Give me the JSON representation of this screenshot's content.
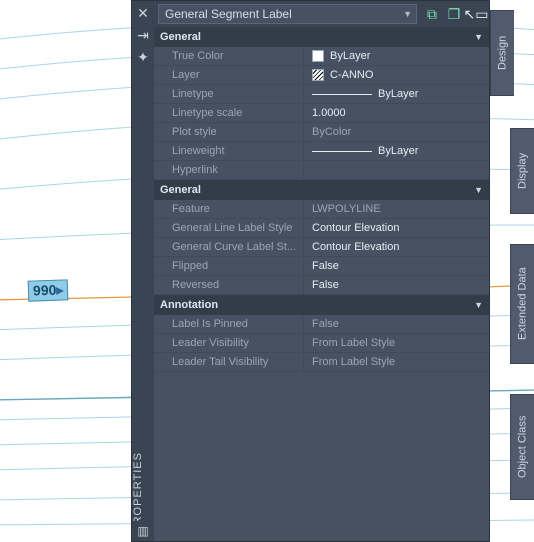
{
  "palette_title": "PROPERTIES",
  "object_selector": "General Segment Label",
  "side_tabs": {
    "design": "Design",
    "display": "Display",
    "extended": "Extended Data",
    "objclass": "Object Class"
  },
  "sections": [
    {
      "title": "General",
      "rows": [
        {
          "label": "True Color",
          "value": "ByLayer",
          "swatch": "white"
        },
        {
          "label": "Layer",
          "value": "C-ANNO",
          "swatch": "hatch"
        },
        {
          "label": "Linetype",
          "value": "ByLayer",
          "line": true
        },
        {
          "label": "Linetype scale",
          "value": "1.0000"
        },
        {
          "label": "Plot style",
          "value": "ByColor",
          "dim": true
        },
        {
          "label": "Lineweight",
          "value": "ByLayer",
          "line": true
        },
        {
          "label": "Hyperlink",
          "value": ""
        }
      ]
    },
    {
      "title": "General",
      "rows": [
        {
          "label": "Feature",
          "value": "LWPOLYLINE",
          "dim": true
        },
        {
          "label": "General Line Label Style",
          "value": "Contour Elevation"
        },
        {
          "label": "General Curve Label St...",
          "value": "Contour Elevation"
        },
        {
          "label": "Flipped",
          "value": "False"
        },
        {
          "label": "Reversed",
          "value": "False"
        }
      ]
    },
    {
      "title": "Annotation",
      "rows": [
        {
          "label": "Label Is Pinned",
          "value": "False",
          "dim": true
        },
        {
          "label": "Leader Visibility",
          "value": "From Label Style",
          "dim": true
        },
        {
          "label": "Leader Tail Visibility",
          "value": "From Label Style",
          "dim": true
        }
      ]
    }
  ],
  "canvas": {
    "elevation_label": "990"
  }
}
